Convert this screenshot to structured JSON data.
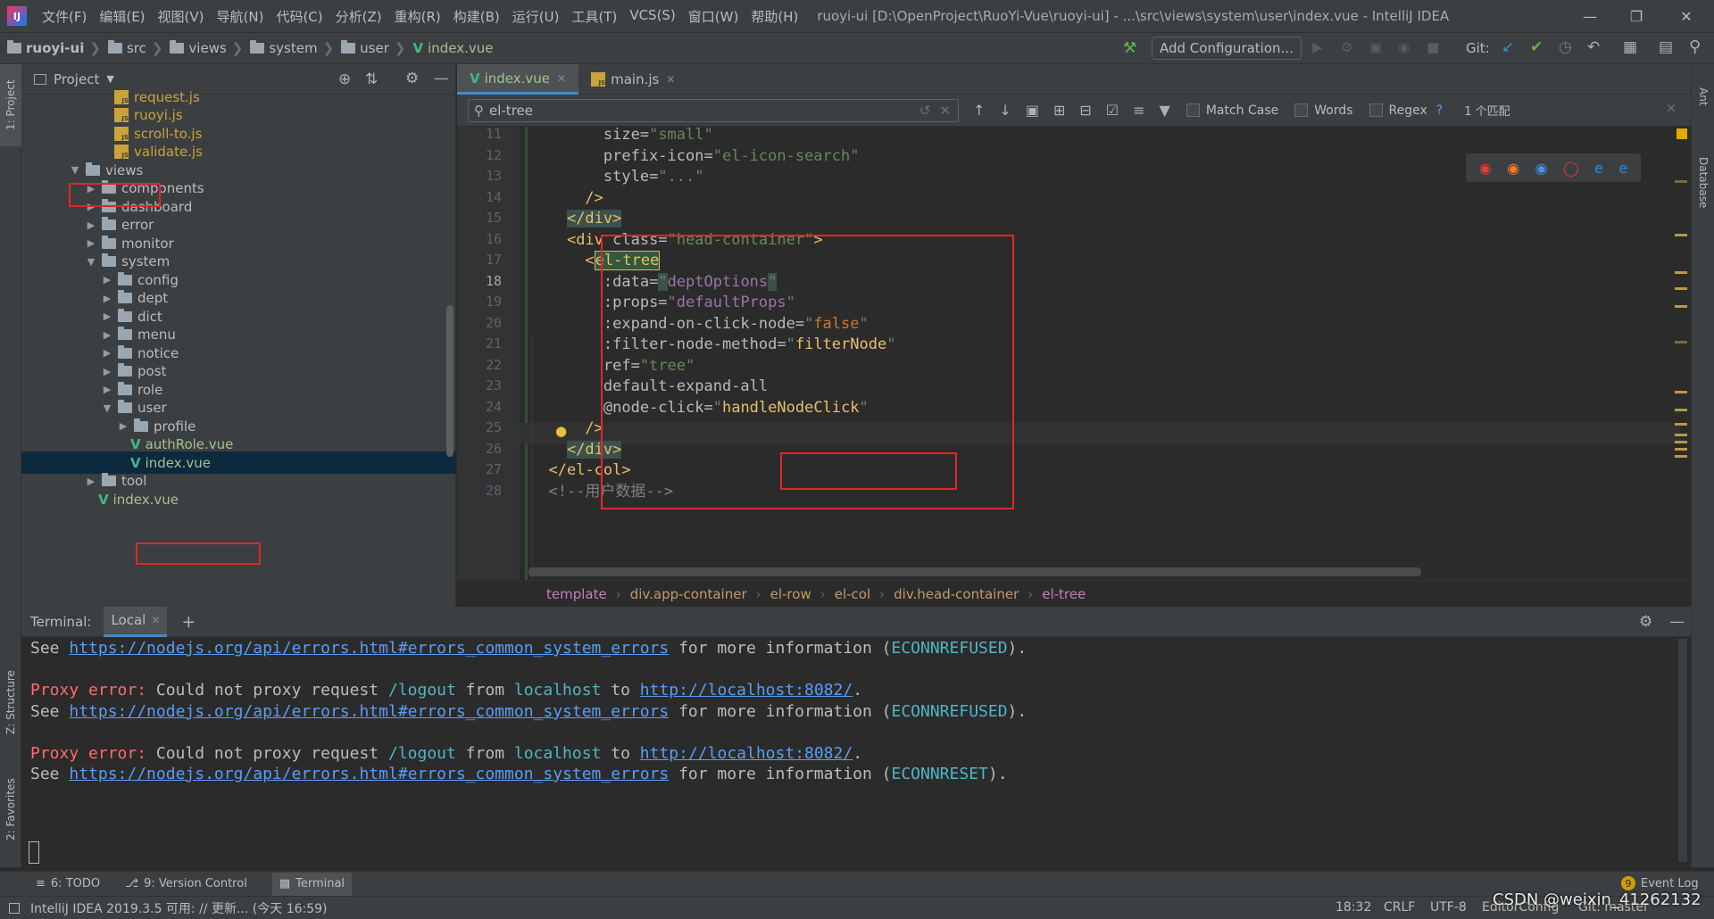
{
  "menubar": {
    "items": [
      "文件(F)",
      "编辑(E)",
      "视图(V)",
      "导航(N)",
      "代码(C)",
      "分析(Z)",
      "重构(R)",
      "构建(B)",
      "运行(U)",
      "工具(T)",
      "VCS(S)",
      "窗口(W)",
      "帮助(H)"
    ],
    "title": "ruoyi-ui [D:\\OpenProject\\RuoYi-Vue\\ruoyi-ui] - ...\\src\\views\\system\\user\\index.vue - IntelliJ IDEA",
    "logo": "IJ"
  },
  "navbar": {
    "crumbs": [
      "ruoyi-ui",
      "src",
      "views",
      "system",
      "user",
      "index.vue"
    ],
    "add_config": "Add Configuration...",
    "git_label": "Git:"
  },
  "project": {
    "title": "Project",
    "tab_label": "1: Project",
    "items": [
      {
        "label": "request.js",
        "type": "js"
      },
      {
        "label": "ruoyi.js",
        "type": "js"
      },
      {
        "label": "scroll-to.js",
        "type": "js"
      },
      {
        "label": "validate.js",
        "type": "js"
      },
      {
        "label": "views",
        "type": "folder",
        "open": true
      },
      {
        "label": "components",
        "type": "folder"
      },
      {
        "label": "dashboard",
        "type": "folder"
      },
      {
        "label": "error",
        "type": "folder"
      },
      {
        "label": "monitor",
        "type": "folder"
      },
      {
        "label": "system",
        "type": "folder",
        "open": true
      },
      {
        "label": "config",
        "type": "folder"
      },
      {
        "label": "dept",
        "type": "folder"
      },
      {
        "label": "dict",
        "type": "folder"
      },
      {
        "label": "menu",
        "type": "folder"
      },
      {
        "label": "notice",
        "type": "folder"
      },
      {
        "label": "post",
        "type": "folder"
      },
      {
        "label": "role",
        "type": "folder"
      },
      {
        "label": "user",
        "type": "folder",
        "open": true
      },
      {
        "label": "profile",
        "type": "folder"
      },
      {
        "label": "authRole.vue",
        "type": "vue"
      },
      {
        "label": "index.vue",
        "type": "vue"
      },
      {
        "label": "tool",
        "type": "folder"
      },
      {
        "label": "index.vue",
        "type": "vue"
      }
    ]
  },
  "tabs": [
    {
      "label": "index.vue",
      "icon": "vue"
    },
    {
      "label": "main.js",
      "icon": "js"
    }
  ],
  "search": {
    "value": "el-tree",
    "match_case": "Match Case",
    "words": "Words",
    "regex": "Regex",
    "help": "?",
    "result": "1 个匹配"
  },
  "editor": {
    "line_numbers": [
      "11",
      "12",
      "13",
      "14",
      "15",
      "16",
      "17",
      "18",
      "19",
      "20",
      "21",
      "22",
      "23",
      "24",
      "25",
      "26",
      "27",
      "28"
    ],
    "lines": [
      {
        "ind": "        ",
        "parts": [
          [
            "attr",
            "size="
          ],
          [
            "str",
            "\"small\""
          ]
        ]
      },
      {
        "ind": "        ",
        "parts": [
          [
            "attr",
            "prefix-icon="
          ],
          [
            "str",
            "\"el-icon-search\""
          ]
        ]
      },
      {
        "ind": "        ",
        "parts": [
          [
            "attr",
            "style="
          ],
          [
            "str",
            "\""
          ],
          [
            "cmt",
            "..."
          ],
          [
            "str",
            "\""
          ]
        ]
      },
      {
        "ind": "      ",
        "parts": [
          [
            "tag",
            "/>"
          ]
        ]
      },
      {
        "ind": "    ",
        "parts": [
          [
            "tag",
            "</div>"
          ]
        ]
      },
      {
        "ind": "    ",
        "parts": [
          [
            "tag",
            "<div "
          ],
          [
            "attr",
            "class="
          ],
          [
            "str",
            "\"head-container\""
          ],
          [
            "tag",
            ">"
          ]
        ]
      },
      {
        "ind": "      ",
        "parts": [
          [
            "tag",
            "<"
          ],
          [
            "tag",
            "el-tree"
          ]
        ]
      },
      {
        "ind": "        ",
        "parts": [
          [
            "attr",
            ":data="
          ],
          [
            "str",
            "\""
          ],
          [
            "vexp",
            "deptOptions"
          ],
          [
            "str",
            "\""
          ]
        ]
      },
      {
        "ind": "        ",
        "parts": [
          [
            "attr",
            ":props="
          ],
          [
            "str",
            "\""
          ],
          [
            "vexp",
            "defaultProps"
          ],
          [
            "str",
            "\""
          ]
        ]
      },
      {
        "ind": "        ",
        "parts": [
          [
            "attr",
            ":expand-on-click-node="
          ],
          [
            "str",
            "\""
          ],
          [
            "kw",
            "false"
          ],
          [
            "str",
            "\""
          ]
        ]
      },
      {
        "ind": "        ",
        "parts": [
          [
            "attr",
            ":filter-node-method="
          ],
          [
            "str",
            "\""
          ],
          [
            "tag",
            "filterNode"
          ],
          [
            "str",
            "\""
          ]
        ]
      },
      {
        "ind": "        ",
        "parts": [
          [
            "attr",
            "ref="
          ],
          [
            "str",
            "\"tree\""
          ]
        ]
      },
      {
        "ind": "        ",
        "parts": [
          [
            "attr",
            "default-expand-all"
          ]
        ]
      },
      {
        "ind": "        ",
        "parts": [
          [
            "attr",
            "@node-click="
          ],
          [
            "str",
            "\""
          ],
          [
            "tag",
            "handleNodeClick"
          ],
          [
            "str",
            "\""
          ]
        ]
      },
      {
        "ind": "      ",
        "parts": [
          [
            "tag",
            "/>"
          ]
        ]
      },
      {
        "ind": "    ",
        "parts": [
          [
            "tag",
            "</div>"
          ]
        ]
      },
      {
        "ind": "  ",
        "parts": [
          [
            "tag",
            "</el-col>"
          ]
        ]
      },
      {
        "ind": "  ",
        "parts": [
          [
            "cmt",
            "<!--用户数据-->"
          ]
        ]
      }
    ]
  },
  "breadcrumb": [
    "template",
    "div.app-container",
    "el-row",
    "el-col",
    "div.head-container",
    "el-tree"
  ],
  "terminal": {
    "label": "Terminal:",
    "tab": "Local",
    "lines": [
      [
        [
          "n",
          "See "
        ],
        [
          "link",
          "https://nodejs.org/api/errors.html#errors_common_system_errors"
        ],
        [
          "n",
          " for more information ("
        ],
        [
          "cyan",
          "ECONNREFUSED"
        ],
        [
          "n",
          ")."
        ]
      ],
      [],
      [
        [
          "red",
          "Proxy error:"
        ],
        [
          "n",
          " Could not proxy request "
        ],
        [
          "cyan",
          "/logout"
        ],
        [
          "n",
          " from "
        ],
        [
          "cyan",
          "localhost"
        ],
        [
          "n",
          " to "
        ],
        [
          "link",
          "http://localhost:8082/"
        ],
        [
          "n",
          "."
        ]
      ],
      [
        [
          "n",
          "See "
        ],
        [
          "link",
          "https://nodejs.org/api/errors.html#errors_common_system_errors"
        ],
        [
          "n",
          " for more information ("
        ],
        [
          "cyan",
          "ECONNREFUSED"
        ],
        [
          "n",
          ")."
        ]
      ],
      [],
      [
        [
          "red",
          "Proxy error:"
        ],
        [
          "n",
          " Could not proxy request "
        ],
        [
          "cyan",
          "/logout"
        ],
        [
          "n",
          " from "
        ],
        [
          "cyan",
          "localhost"
        ],
        [
          "n",
          " to "
        ],
        [
          "link",
          "http://localhost:8082/"
        ],
        [
          "n",
          "."
        ]
      ],
      [
        [
          "n",
          "See "
        ],
        [
          "link",
          "https://nodejs.org/api/errors.html#errors_common_system_errors"
        ],
        [
          "n",
          " for more information ("
        ],
        [
          "cyan",
          "ECONNRESET"
        ],
        [
          "n",
          ")."
        ]
      ]
    ]
  },
  "side_tabs": {
    "structure": "Z: Structure",
    "favorites": "2: Favorites",
    "ant": "Ant",
    "database": "Database"
  },
  "toolwindows": [
    {
      "label": "6: TODO",
      "icon": "list-icon"
    },
    {
      "label": "9: Version Control",
      "icon": "branch-icon"
    },
    {
      "label": "Terminal",
      "icon": "terminal-icon"
    }
  ],
  "event_log": {
    "count": "9",
    "label": "Event Log"
  },
  "status": {
    "message": "IntelliJ IDEA 2019.3.5 可用: // 更新... (今天 16:59)",
    "position": "18:32",
    "line_sep": "CRLF",
    "encoding": "UTF-8",
    "editorconfig": "EditorConfig",
    "git": "Git: master"
  },
  "watermark": "CSDN @weixin_41262132",
  "colors": {
    "accent": "#4a88c7",
    "highlight_box": "#e0272c",
    "vue": "#41b883"
  }
}
